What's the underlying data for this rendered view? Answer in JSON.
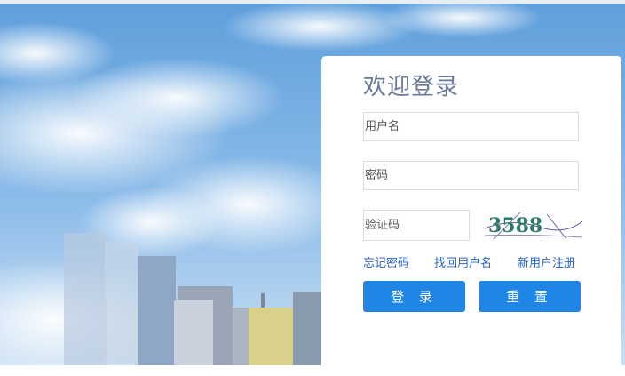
{
  "login": {
    "title": "欢迎登录",
    "username_placeholder": "用户名",
    "password_placeholder": "密码",
    "captcha_placeholder": "验证码",
    "captcha_text": "3588",
    "forgot_password": "忘记密码",
    "find_username": "找回用户名",
    "register": "新用户注册",
    "login_button": "登 录",
    "reset_button": "重 置"
  },
  "colors": {
    "accent": "#1f86e6",
    "link": "#2b63c9",
    "title": "#6a7a96"
  }
}
